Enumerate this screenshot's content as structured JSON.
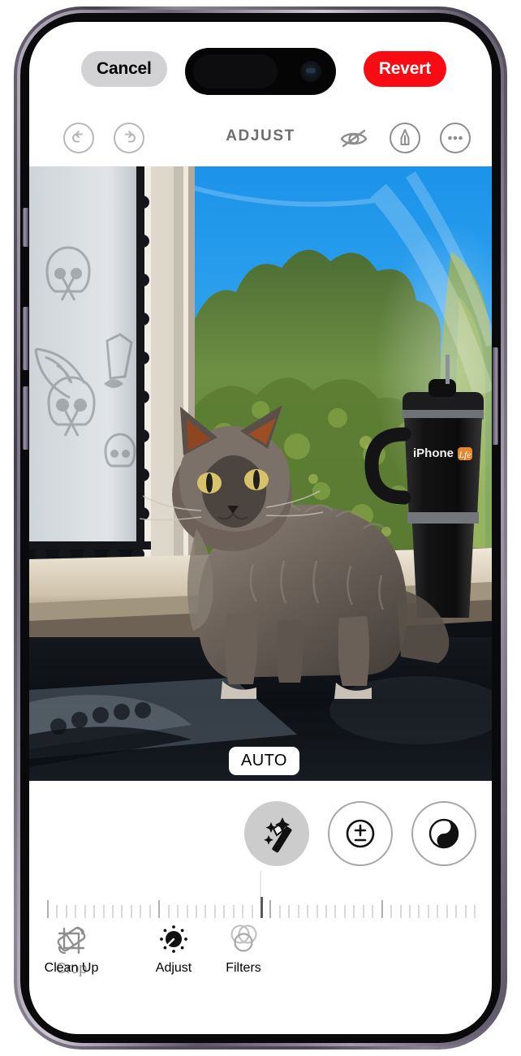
{
  "app": {
    "screen_name": "Photos Editor",
    "device": "iPhone"
  },
  "top_nav": {
    "cancel_label": "Cancel",
    "revert_label": "Revert",
    "cancel_bg": "#d2d2d4",
    "revert_bg": "#f80b13",
    "revert_text_color": "#ffffff"
  },
  "edit_toolbar": {
    "title": "ADJUST",
    "undo_icon": "undo-icon",
    "redo_icon": "redo-icon",
    "hide_markup_icon": "eye-slash-icon",
    "markup_icon": "markup-pen-icon",
    "more_icon": "ellipsis-icon",
    "icon_color": "#b8b8b8",
    "title_color": "#6e6e6e"
  },
  "photo": {
    "alt": "Fluffy gray cat sitting on a dark countertop in front of a sunlit window with trees and blue sky, skull-pattern curtain at left, black tumbler at right",
    "auto_badge": "AUTO",
    "subject": "cat",
    "scene_elements": [
      "skull-pattern curtain",
      "white window frame",
      "blue sky",
      "green trees",
      "gray long-haired cat",
      "black tumbler",
      "dark countertop"
    ],
    "tumbler_brand": "iPhone Life",
    "sky_color": "#1f9ae8",
    "tree_color": "#6f8c3e",
    "counter_color": "#0f1216"
  },
  "adjust_tools": [
    {
      "name": "auto-adjust",
      "icon": "magic-wand-icon",
      "selected": true
    },
    {
      "name": "exposure",
      "icon": "plus-minus-icon",
      "selected": false
    },
    {
      "name": "contrast",
      "icon": "contrast-icon",
      "selected": false
    }
  ],
  "slider": {
    "name": "intensity-slider",
    "tick_count": 47,
    "value_index": 23,
    "tick_color": "#d9d9d9",
    "center_tick_color": "#5a5a5a"
  },
  "mode_tabs": [
    {
      "label": "Adjust",
      "icon": "dial-icon",
      "active": true,
      "highlighted": false
    },
    {
      "label": "Filters",
      "icon": "filters-icon",
      "active": false,
      "highlighted": false
    },
    {
      "label": "Crop",
      "icon": "crop-icon",
      "active": false,
      "highlighted": false
    },
    {
      "label": "Clean Up",
      "icon": "eraser-icon",
      "active": false,
      "highlighted": true
    }
  ],
  "highlight": {
    "target": "Clean Up",
    "color": "#f8252f"
  }
}
